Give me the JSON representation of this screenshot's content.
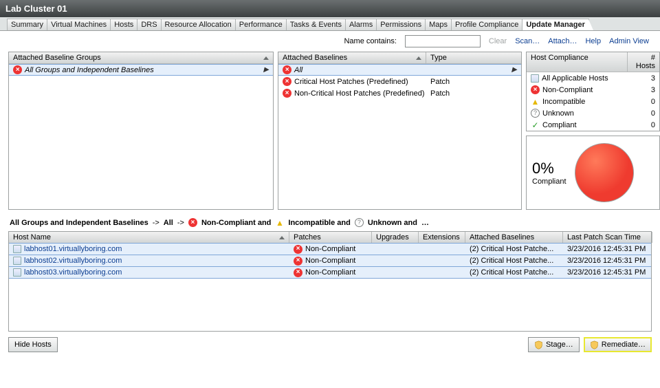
{
  "title": "Lab Cluster 01",
  "tabs": [
    "Summary",
    "Virtual Machines",
    "Hosts",
    "DRS",
    "Resource Allocation",
    "Performance",
    "Tasks & Events",
    "Alarms",
    "Permissions",
    "Maps",
    "Profile Compliance",
    "Update Manager"
  ],
  "active_tab": 11,
  "toolbar": {
    "label": "Name contains:",
    "value": "",
    "clear": "Clear",
    "scan": "Scan…",
    "attach": "Attach…",
    "help": "Help",
    "admin": "Admin View"
  },
  "groups_panel": {
    "header": "Attached Baseline Groups",
    "row": "All Groups and Independent Baselines"
  },
  "baselines_panel": {
    "header": "Attached Baselines",
    "type_header": "Type",
    "rows": [
      {
        "name": "All",
        "type": "",
        "icon": "red",
        "arrow": true
      },
      {
        "name": "Critical Host Patches (Predefined)",
        "type": "Patch",
        "icon": "red"
      },
      {
        "name": "Non-Critical Host Patches (Predefined)",
        "type": "Patch",
        "icon": "red"
      }
    ]
  },
  "compliance_panel": {
    "header": "Host Compliance",
    "hosts_header": "# Hosts",
    "rows": [
      {
        "icon": "host",
        "label": "All Applicable Hosts",
        "count": "3"
      },
      {
        "icon": "red",
        "label": "Non-Compliant",
        "count": "3"
      },
      {
        "icon": "warn",
        "label": "Incompatible",
        "count": "0"
      },
      {
        "icon": "q",
        "label": "Unknown",
        "count": "0"
      },
      {
        "icon": "check",
        "label": "Compliant",
        "count": "0"
      }
    ],
    "percent": "0%",
    "percent_label": "Compliant"
  },
  "breadcrumb": {
    "b1": "All Groups and Independent Baselines",
    "arrow": "->",
    "b2": "All",
    "nc": "Non-Compliant and",
    "inc": "Incompatible and",
    "unk": "Unknown and",
    "ellipsis": "…"
  },
  "grid": {
    "headers": [
      "Host Name",
      "Patches",
      "Upgrades",
      "Extensions",
      "Attached Baselines",
      "Last Patch Scan Time"
    ],
    "rows": [
      {
        "host": "labhost01.virtuallyboring.com",
        "patches": "Non-Compliant",
        "baselines": "(2) Critical Host Patche...",
        "scan": "3/23/2016 12:45:31 PM"
      },
      {
        "host": "labhost02.virtuallyboring.com",
        "patches": "Non-Compliant",
        "baselines": "(2) Critical Host Patche...",
        "scan": "3/23/2016 12:45:31 PM"
      },
      {
        "host": "labhost03.virtuallyboring.com",
        "patches": "Non-Compliant",
        "baselines": "(2) Critical Host Patche...",
        "scan": "3/23/2016 12:45:31 PM"
      }
    ]
  },
  "footer": {
    "hide": "Hide Hosts",
    "stage": "Stage…",
    "remediate": "Remediate…"
  },
  "chart_data": {
    "type": "pie",
    "title": "Compliant",
    "categories": [
      "Non-Compliant",
      "Compliant"
    ],
    "values": [
      100,
      0
    ]
  }
}
